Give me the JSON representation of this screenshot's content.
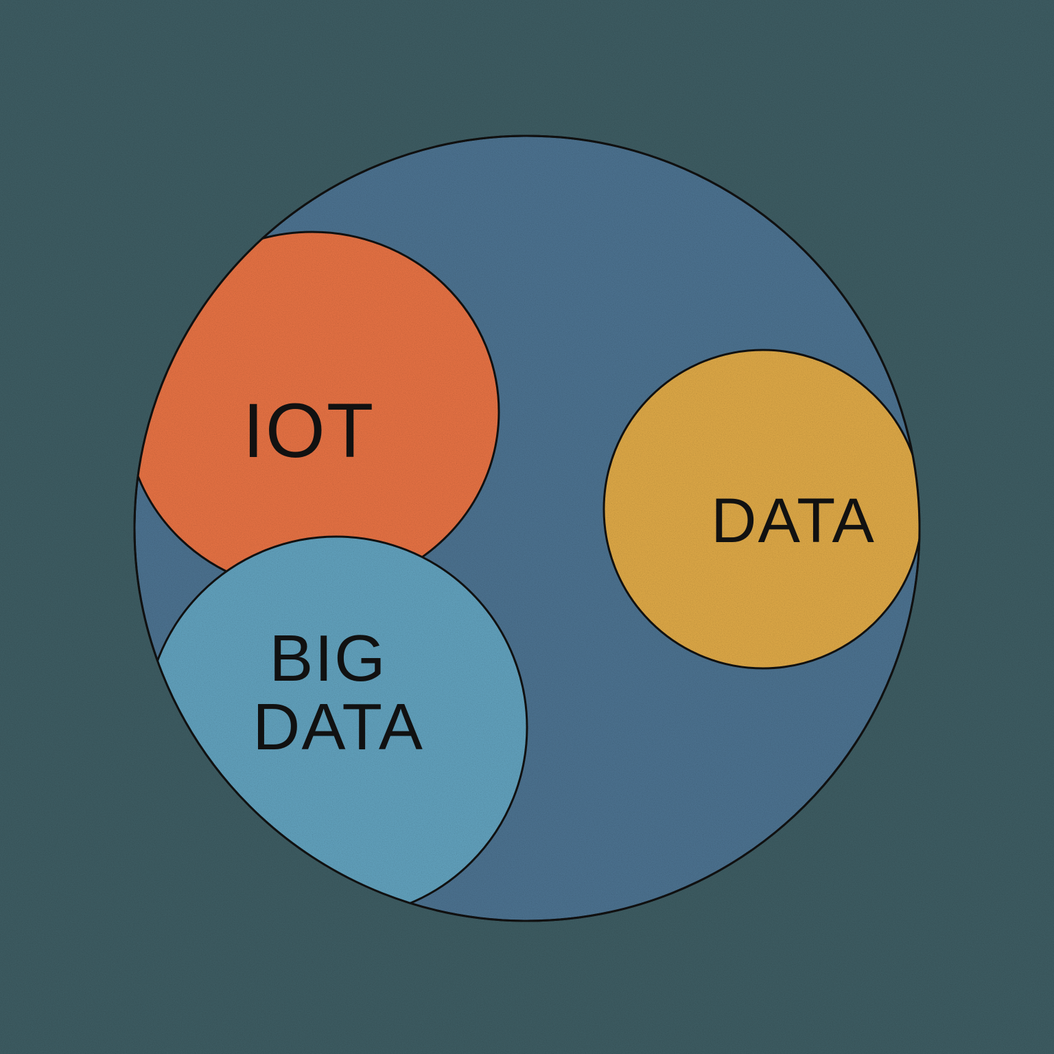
{
  "colors": {
    "background": "#3c5a60",
    "outer_circle": "#4a6f8c",
    "iot_circle": "#e06f42",
    "big_data_circle": "#5f9db8",
    "data_circle": "#d8a445",
    "outline": "#111111",
    "text": "#111111"
  },
  "diagram": {
    "iot_label": "IOT",
    "big_data_label_line1": "BIG",
    "big_data_label_line2": "DATA",
    "data_label": "DATA"
  }
}
